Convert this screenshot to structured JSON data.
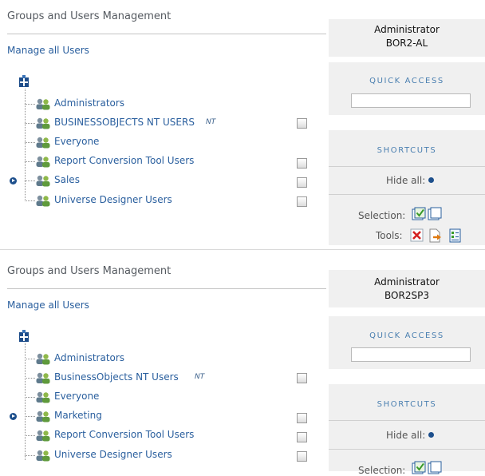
{
  "panels": [
    {
      "title": "Groups and Users Management",
      "manage_all": "Manage all Users",
      "rows": [
        {
          "label": "Administrators",
          "nt": "",
          "checkbox": false,
          "expand": false
        },
        {
          "label": "BUSINESSOBJECTS NT USERS",
          "nt": "NT",
          "checkbox": true,
          "expand": false
        },
        {
          "label": "Everyone",
          "nt": "",
          "checkbox": false,
          "expand": false
        },
        {
          "label": "Report Conversion Tool Users",
          "nt": "",
          "checkbox": true,
          "expand": false
        },
        {
          "label": "Sales",
          "nt": "",
          "checkbox": true,
          "expand": true
        },
        {
          "label": "Universe Designer Users",
          "nt": "",
          "checkbox": true,
          "expand": false
        }
      ],
      "side": {
        "user": "Administrator",
        "server": "BOR2-AL",
        "quick_access": "QUICK ACCESS",
        "quick_access_value": "",
        "shortcuts": "SHORTCUTS",
        "hide_all": "Hide all:",
        "selection": "Selection:",
        "tools": "Tools:"
      }
    },
    {
      "title": "Groups and Users Management",
      "manage_all": "Manage all Users",
      "rows": [
        {
          "label": "Administrators",
          "nt": "",
          "checkbox": false,
          "expand": false
        },
        {
          "label": "BusinessObjects NT Users",
          "nt": "NT",
          "checkbox": true,
          "expand": false
        },
        {
          "label": "Everyone",
          "nt": "",
          "checkbox": false,
          "expand": false
        },
        {
          "label": "Marketing",
          "nt": "",
          "checkbox": true,
          "expand": true
        },
        {
          "label": "Report Conversion Tool Users",
          "nt": "",
          "checkbox": true,
          "expand": false
        },
        {
          "label": "Universe Designer Users",
          "nt": "",
          "checkbox": true,
          "expand": false
        }
      ],
      "side": {
        "user": "Administrator",
        "server": "BOR2SP3",
        "quick_access": "QUICK ACCESS",
        "quick_access_value": "",
        "shortcuts": "SHORTCUTS",
        "hide_all": "Hide all:",
        "selection": "Selection:",
        "tools": ""
      }
    }
  ],
  "icons": {
    "root": "add-group-icon",
    "group": "user-group-icon",
    "expand": "expand-icon",
    "select_all": "select-all-icon",
    "deselect": "deselect-icon",
    "delete": "delete-icon",
    "export": "export-icon",
    "properties": "properties-icon"
  },
  "colors": {
    "link": "#2a5f9e",
    "accent_caps": "#4a7fb0",
    "side_bg": "#f0f0f0",
    "expand_dot": "#1d4f8c"
  }
}
